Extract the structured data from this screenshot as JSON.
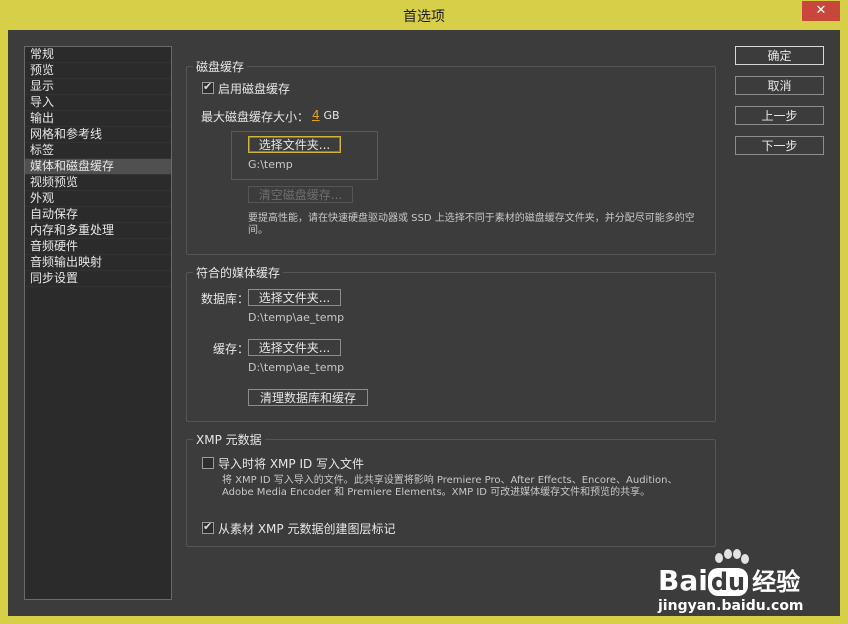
{
  "window": {
    "title": "首选项",
    "close_glyph": "✕"
  },
  "sidebar": {
    "items": [
      {
        "label": "常规"
      },
      {
        "label": "预览"
      },
      {
        "label": "显示"
      },
      {
        "label": "导入"
      },
      {
        "label": "输出"
      },
      {
        "label": "网格和参考线"
      },
      {
        "label": "标签"
      },
      {
        "label": "媒体和磁盘缓存"
      },
      {
        "label": "视频预览"
      },
      {
        "label": "外观"
      },
      {
        "label": "自动保存"
      },
      {
        "label": "内存和多重处理"
      },
      {
        "label": "音频硬件"
      },
      {
        "label": "音频输出映射"
      },
      {
        "label": "同步设置"
      }
    ],
    "active_index": 7
  },
  "disk_cache": {
    "title": "磁盘缓存",
    "enable_label": "启用磁盘缓存",
    "enabled": true,
    "max_size_label": "最大磁盘缓存大小：",
    "max_size_value": "4",
    "max_size_unit": "GB",
    "choose_folder": "选择文件夹...",
    "path": "G:\\temp",
    "clear_button": "清空磁盘缓存...",
    "note": "要提高性能，请在快速硬盘驱动器或 SSD 上选择不同于素材的磁盘缓存文件夹，并分配尽可能多的空间。"
  },
  "media_cache": {
    "title": "符合的媒体缓存",
    "database_label": "数据库：",
    "database_button": "选择文件夹...",
    "database_path": "D:\\temp\\ae_temp",
    "cache_label": "缓存：",
    "cache_button": "选择文件夹...",
    "cache_path": "D:\\temp\\ae_temp",
    "clear_button": "清理数据库和缓存"
  },
  "xmp": {
    "title": "XMP 元数据",
    "write_label": "导入时将 XMP ID 写入文件",
    "write_checked": false,
    "note": "将 XMP ID 写入导入的文件。此共享设置将影响 Premiere Pro、After Effects、Encore、Audition、Adobe Media Encoder 和 Premiere Elements。XMP ID 可改进媒体缓存文件和预览的共享。",
    "marker_label": "从素材 XMP 元数据创建图层标记",
    "marker_checked": true
  },
  "buttons": {
    "ok": "确定",
    "cancel": "取消",
    "previous": "上一步",
    "next": "下一步"
  },
  "watermark": {
    "brand_bai": "Bai",
    "brand_du": "du",
    "brand_cn": "经验",
    "url": "jingyan.baidu.com"
  },
  "colors": {
    "title_bar": "#d7cf47",
    "panel": "#3c3c3c",
    "accent_orange": "#e3a31d",
    "highlight_red": "#d8232a"
  }
}
